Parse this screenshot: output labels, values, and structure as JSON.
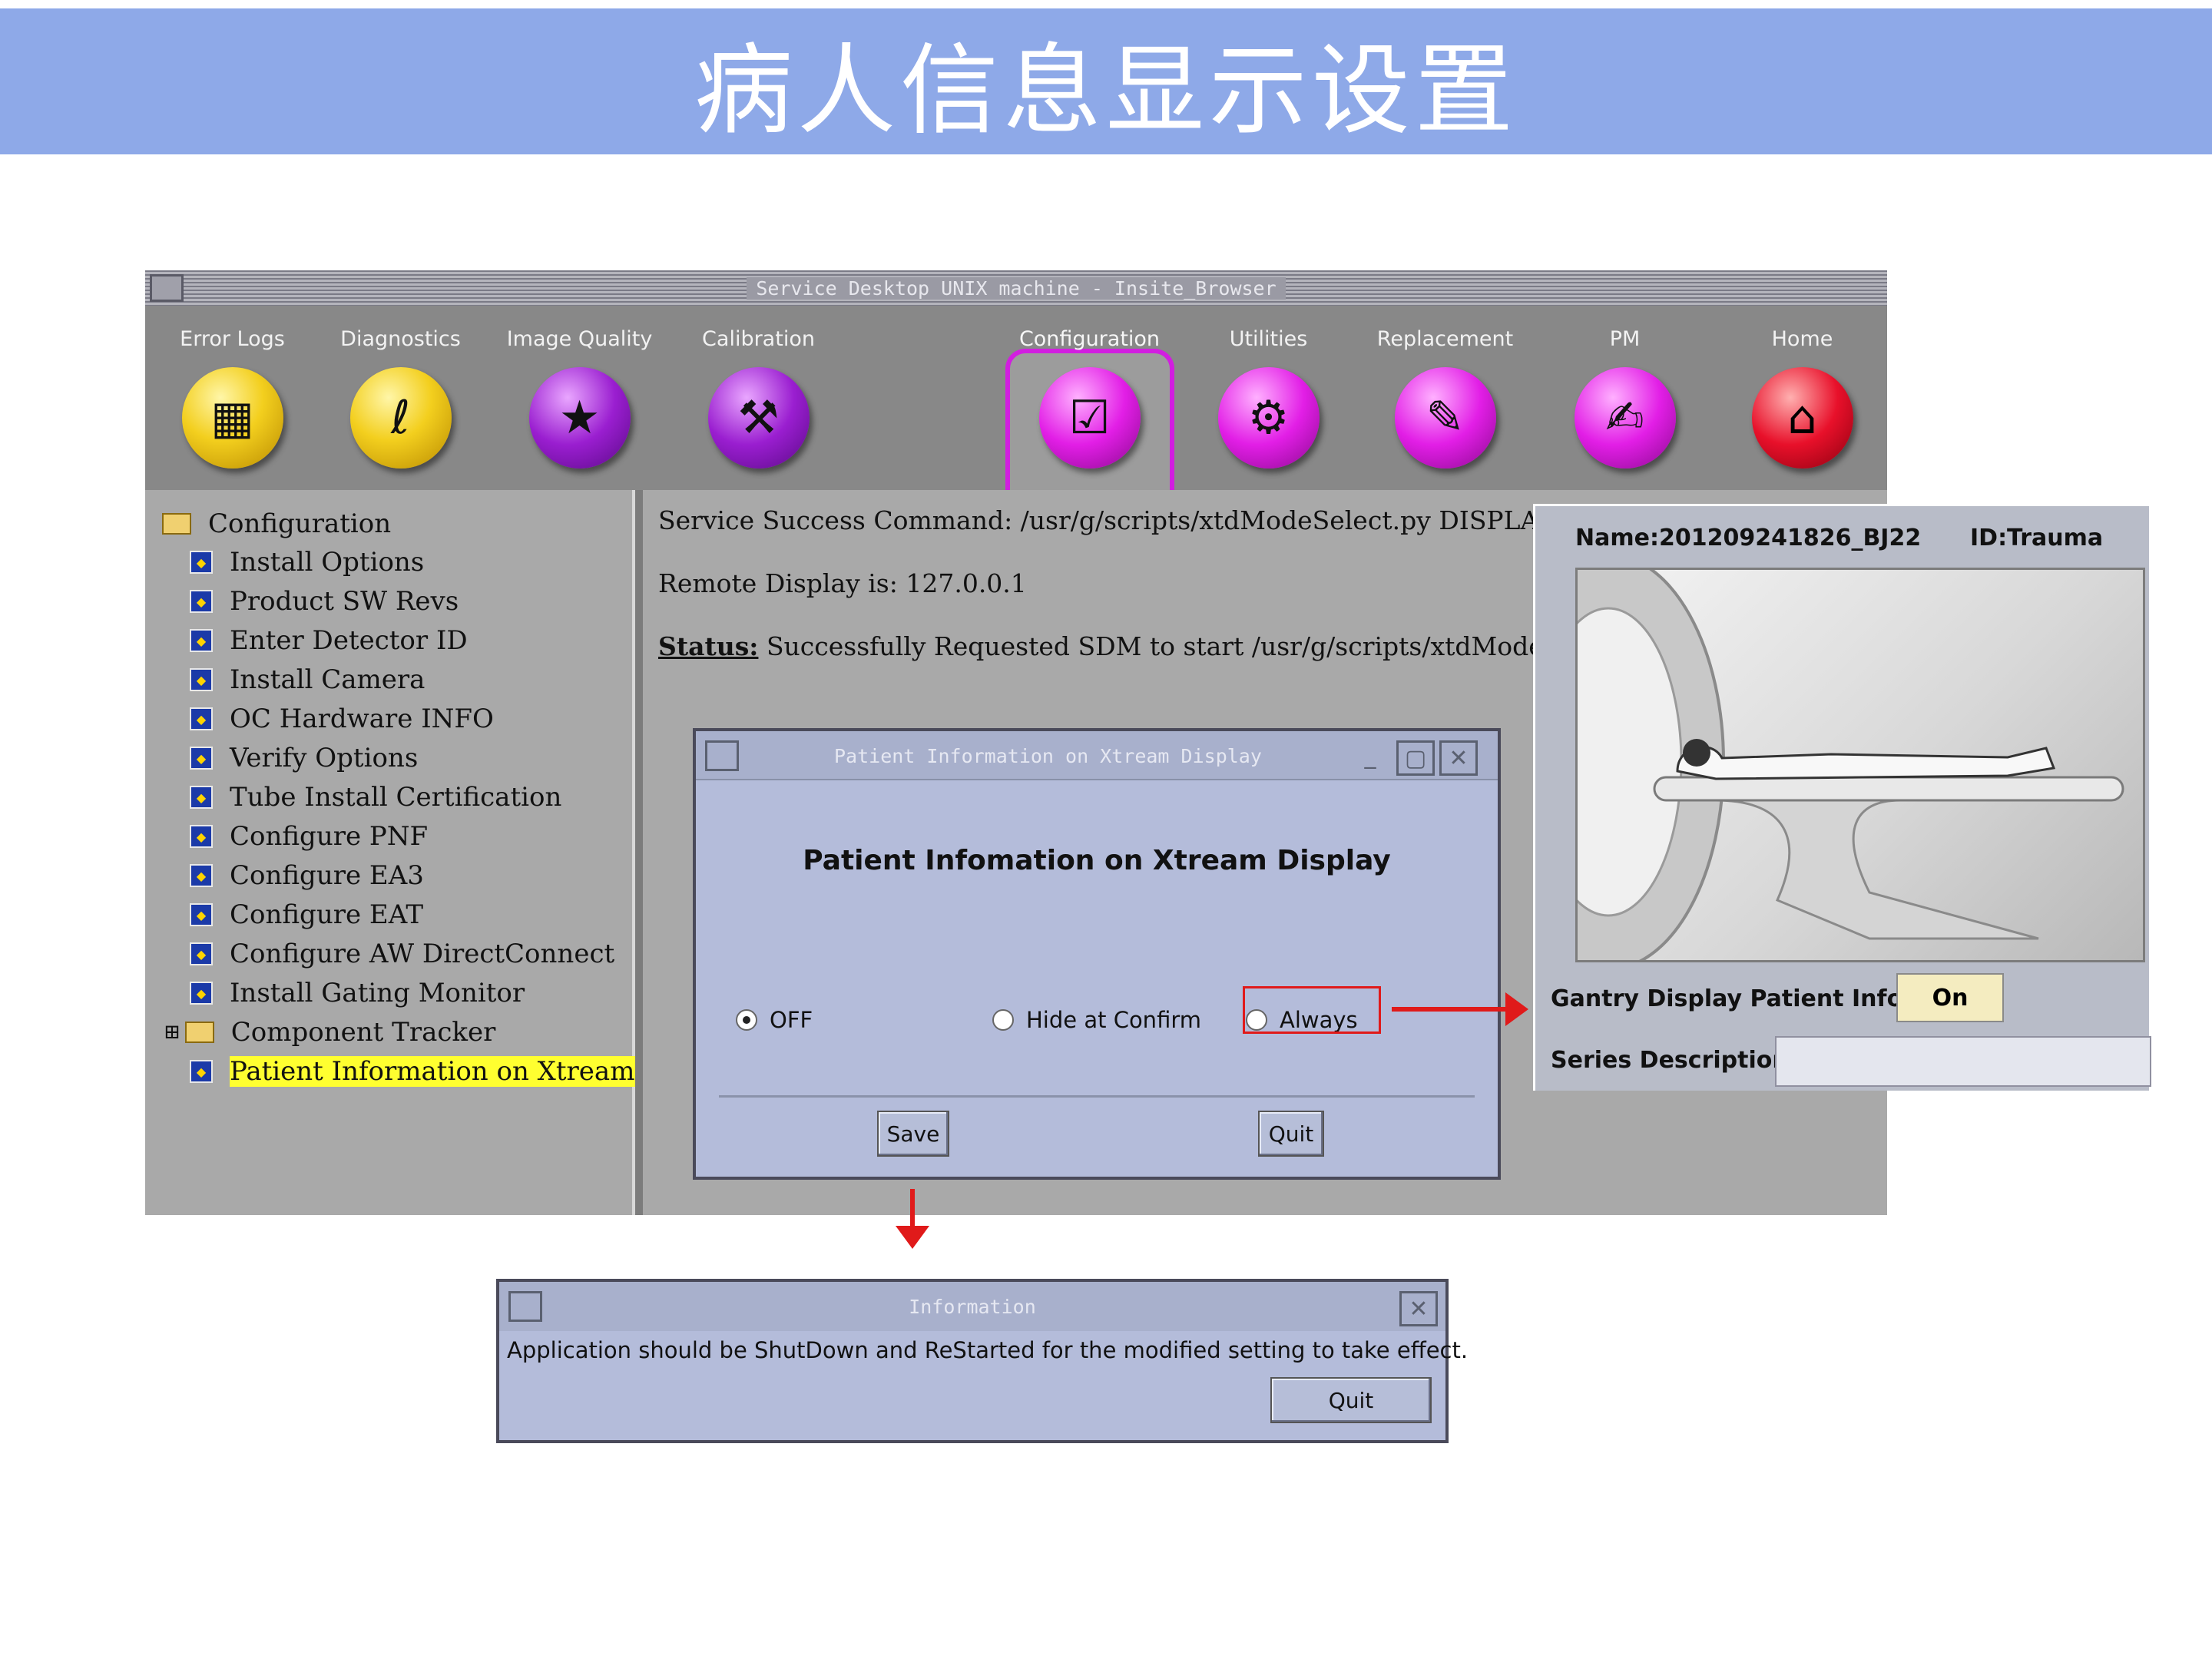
{
  "slide": {
    "title": "病人信息显示设置"
  },
  "main_window": {
    "title": "Service Desktop UNIX machine - Insite_Browser",
    "toolbar": [
      {
        "label": "Error Logs",
        "icon": "table-icon",
        "glyph": "▦",
        "color": "yellow"
      },
      {
        "label": "Diagnostics",
        "icon": "stethoscope-icon",
        "glyph": "ℓ",
        "color": "yellow"
      },
      {
        "label": "Image Quality",
        "icon": "monitor-star-icon",
        "glyph": "★",
        "color": "purple"
      },
      {
        "label": "Calibration",
        "icon": "hammer-icon",
        "glyph": "⚒",
        "color": "purple"
      },
      {
        "label": "Configuration",
        "icon": "checklist-icon",
        "glyph": "☑",
        "color": "magenta",
        "active": true
      },
      {
        "label": "Utilities",
        "icon": "toolbox-icon",
        "glyph": "⚙",
        "color": "magenta"
      },
      {
        "label": "Replacement",
        "icon": "wrench-icon",
        "glyph": "✎",
        "color": "magenta"
      },
      {
        "label": "PM",
        "icon": "clipboard-tool-icon",
        "glyph": "✍",
        "color": "magenta"
      },
      {
        "label": "Home",
        "icon": "home-icon",
        "glyph": "⌂",
        "color": "red"
      }
    ],
    "tree": {
      "root": "Configuration",
      "items": [
        "Install Options",
        "Product SW Revs",
        "Enter Detector ID",
        "Install Camera",
        "OC Hardware INFO",
        "Verify Options",
        "Tube Install Certification",
        "Configure PNF",
        "Configure EA3",
        "Configure EAT",
        "Configure AW DirectConnect",
        "Install Gating Monitor",
        "Component Tracker",
        "Patient Information on Xtream Dis"
      ]
    },
    "content": {
      "command": "Service Success Command: /usr/g/scripts/xtdModeSelect.py DISPLAY: /tmp",
      "remote": "Remote Display is: 127.0.0.1",
      "status_label": "Status:",
      "status_text": " Successfully Requested SDM to start /usr/g/scripts/xtdModeSelect.p"
    }
  },
  "patient_dialog": {
    "title": "Patient Information on Xtream Display",
    "heading": "Patient Infomation on Xtream Display",
    "options": [
      {
        "label": "OFF",
        "selected": true
      },
      {
        "label": "Hide at Confirm",
        "selected": false
      },
      {
        "label": "Always",
        "selected": false
      }
    ],
    "save_label": "Save",
    "quit_label": "Quit"
  },
  "side_panel": {
    "name": "Name:201209241826_BJ22",
    "id": "ID:Trauma",
    "gantry_label": "Gantry Display Patient Info.",
    "gantry_value": "On",
    "series_label": "Series Description",
    "series_value": ""
  },
  "info_dialog": {
    "title": "Information",
    "message": "Application should be ShutDown and ReStarted for the modified setting to take effect.",
    "quit_label": "Quit"
  },
  "colors": {
    "header": "#8ea9e8",
    "accent": "#d21ee0",
    "annotation": "#e01a1a"
  }
}
